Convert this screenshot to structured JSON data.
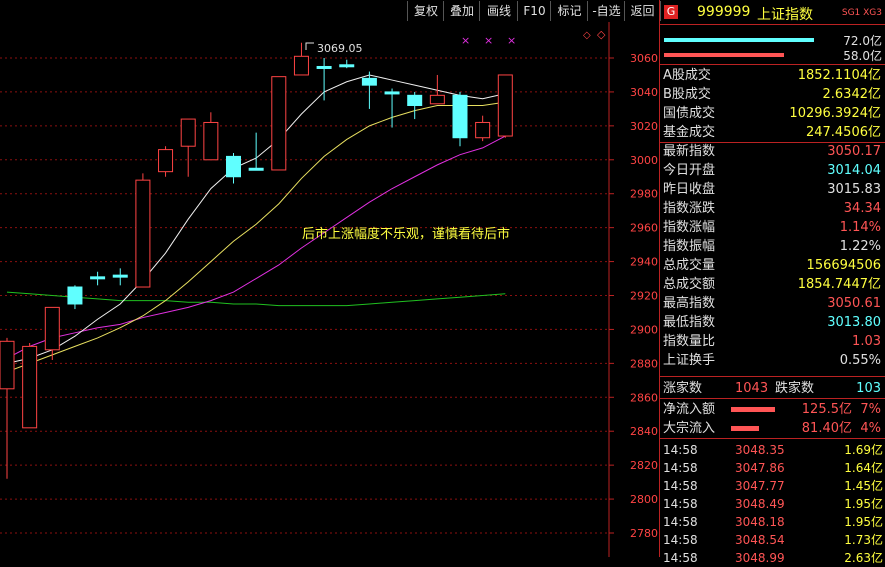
{
  "toolbar": {
    "buttons": [
      "复权",
      "叠加",
      "画线",
      "F10",
      "标记",
      "-自选",
      "返回"
    ]
  },
  "chart": {
    "annotation": "后市上涨幅度不乐观，谨慎看待后市",
    "high_label": "3069.05",
    "y_ticks": [
      "3060",
      "3040",
      "3020",
      "3000",
      "2980",
      "2960",
      "2940",
      "2920",
      "2900",
      "2880",
      "2860",
      "2840",
      "2820",
      "2800",
      "2780"
    ],
    "marks": [
      "×",
      "×",
      "×"
    ],
    "candles": [
      {
        "o": 2865,
        "c": 2893,
        "h": 2895,
        "l": 2812
      },
      {
        "o": 2842,
        "c": 2890,
        "h": 2892,
        "l": 2842
      },
      {
        "o": 2888,
        "c": 2913,
        "h": 2913,
        "l": 2882
      },
      {
        "o": 2925,
        "c": 2915,
        "h": 2926,
        "l": 2912
      },
      {
        "o": 2931,
        "c": 2931,
        "h": 2934,
        "l": 2926
      },
      {
        "o": 2932,
        "c": 2932,
        "h": 2936,
        "l": 2926
      },
      {
        "o": 2925,
        "c": 2988,
        "h": 2992,
        "l": 2925
      },
      {
        "o": 2993,
        "c": 3006,
        "h": 3008,
        "l": 2990
      },
      {
        "o": 3008,
        "c": 3024,
        "h": 3024,
        "l": 2990
      },
      {
        "o": 3000,
        "c": 3022,
        "h": 3028,
        "l": 3000
      },
      {
        "o": 3002,
        "c": 2990,
        "h": 3004,
        "l": 2986
      },
      {
        "o": 2995,
        "c": 2995,
        "h": 3016,
        "l": 2995
      },
      {
        "o": 2994,
        "c": 3049,
        "h": 3049,
        "l": 2994
      },
      {
        "o": 3050,
        "c": 3061,
        "h": 3069,
        "l": 3050
      },
      {
        "o": 3055,
        "c": 3055,
        "h": 3060,
        "l": 3035
      },
      {
        "o": 3056,
        "c": 3056,
        "h": 3059,
        "l": 3054
      },
      {
        "o": 3048,
        "c": 3044,
        "h": 3052,
        "l": 3030
      },
      {
        "o": 3040,
        "c": 3040,
        "h": 3042,
        "l": 3019
      },
      {
        "o": 3038,
        "c": 3032,
        "h": 3040,
        "l": 3024
      },
      {
        "o": 3033,
        "c": 3038,
        "h": 3050,
        "l": 3033
      },
      {
        "o": 3038,
        "c": 3013,
        "h": 3040,
        "l": 3008
      },
      {
        "o": 3013,
        "c": 3022,
        "h": 3026,
        "l": 3011
      },
      {
        "o": 3014,
        "c": 3050,
        "h": 3050,
        "l": 3013
      }
    ],
    "ma_white": [
      2880,
      2883,
      2888,
      2896,
      2906,
      2915,
      2929,
      2945,
      2965,
      2983,
      2995,
      3001,
      3012,
      3027,
      3040,
      3046,
      3050,
      3047,
      3044,
      3041,
      3038,
      3036,
      3039
    ],
    "ma_yellow": [
      2875,
      2880,
      2885,
      2890,
      2895,
      2901,
      2908,
      2917,
      2928,
      2940,
      2952,
      2962,
      2974,
      2989,
      3002,
      3012,
      3020,
      3025,
      3029,
      3032,
      3032,
      3032,
      3034
    ],
    "ma_magenta": [
      2883,
      2890,
      2895,
      2898,
      2901,
      2903,
      2907,
      2910,
      2913,
      2917,
      2922,
      2930,
      2938,
      2948,
      2957,
      2966,
      2975,
      2983,
      2990,
      2997,
      3003,
      3007,
      3014
    ],
    "ma_green": [
      2922,
      2921,
      2920,
      2919,
      2918,
      2917,
      2917,
      2917,
      2916,
      2916,
      2915,
      2915,
      2914,
      2914,
      2914,
      2914,
      2915,
      2916,
      2917,
      2918,
      2919,
      2920,
      2921
    ]
  },
  "panel": {
    "badge": "G",
    "code": "999999",
    "name": "上证指数",
    "tags": "SG1 XG3",
    "bar1_value": "72.0亿",
    "bar2_value": "58.0亿",
    "rows": [
      {
        "label": "A股成交",
        "value": "1852.1104亿",
        "color": "#ffff40"
      },
      {
        "label": "B股成交",
        "value": "2.6342亿",
        "color": "#ffff40"
      },
      {
        "label": "国债成交",
        "value": "10296.3924亿",
        "color": "#ffff40"
      },
      {
        "label": "基金成交",
        "value": "247.4506亿",
        "color": "#ffff40"
      },
      {
        "label": "最新指数",
        "value": "3050.17",
        "color": "#ff5555"
      },
      {
        "label": "今日开盘",
        "value": "3014.04",
        "color": "#60ffff"
      },
      {
        "label": "昨日收盘",
        "value": "3015.83",
        "color": "#e0e0e0"
      },
      {
        "label": "指数涨跌",
        "value": "34.34",
        "color": "#ff5555"
      },
      {
        "label": "指数涨幅",
        "value": "1.14%",
        "color": "#ff5555"
      },
      {
        "label": "指数振幅",
        "value": "1.22%",
        "color": "#e0e0e0"
      },
      {
        "label": "总成交量",
        "value": "156694506",
        "color": "#ffff40"
      },
      {
        "label": "总成交额",
        "value": "1854.7447亿",
        "color": "#ffff40"
      },
      {
        "label": "最高指数",
        "value": "3050.61",
        "color": "#ff5555"
      },
      {
        "label": "最低指数",
        "value": "3013.80",
        "color": "#60ffff"
      },
      {
        "label": "指数量比",
        "value": "1.03",
        "color": "#ff5555"
      },
      {
        "label": "上证换手",
        "value": "0.55%",
        "color": "#e0e0e0"
      }
    ],
    "up_label": "涨家数",
    "up_value": "1043",
    "down_label": "跌家数",
    "down_value": "103",
    "flow": [
      {
        "label": "净流入额",
        "value": "125.5亿",
        "pct": "7%"
      },
      {
        "label": "大宗流入",
        "value": "81.40亿",
        "pct": "4%"
      }
    ],
    "ticks": [
      {
        "time": "14:58",
        "price": "3048.35",
        "amount": "1.69亿"
      },
      {
        "time": "14:58",
        "price": "3047.86",
        "amount": "1.64亿"
      },
      {
        "time": "14:58",
        "price": "3047.77",
        "amount": "1.45亿"
      },
      {
        "time": "14:58",
        "price": "3048.49",
        "amount": "1.95亿"
      },
      {
        "time": "14:58",
        "price": "3048.18",
        "amount": "1.95亿"
      },
      {
        "time": "14:58",
        "price": "3048.54",
        "amount": "1.73亿"
      },
      {
        "time": "14:58",
        "price": "3048.99",
        "amount": "2.63亿"
      }
    ]
  }
}
